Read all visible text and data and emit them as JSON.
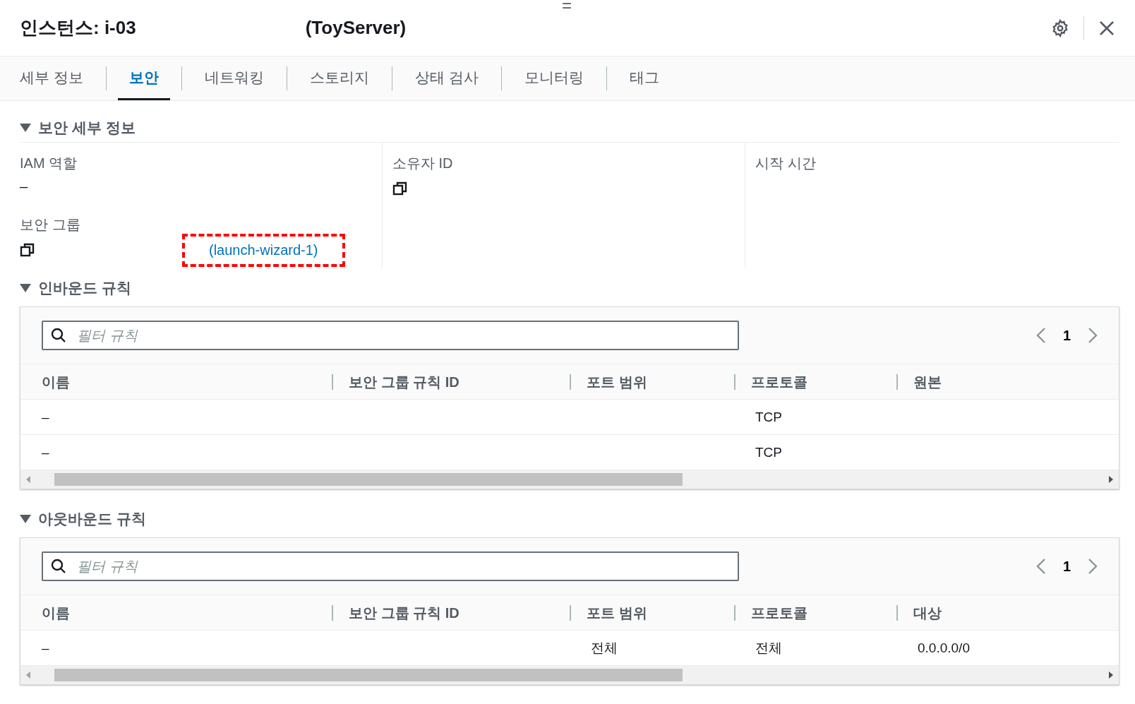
{
  "header": {
    "title": "인스턴스: i-03",
    "subtitle": "(ToyServer)",
    "handle": "="
  },
  "tabs": [
    {
      "label": "세부 정보",
      "selected": false
    },
    {
      "label": "보안",
      "selected": true
    },
    {
      "label": "네트워킹",
      "selected": false
    },
    {
      "label": "스토리지",
      "selected": false
    },
    {
      "label": "상태 검사",
      "selected": false
    },
    {
      "label": "모니터링",
      "selected": false
    },
    {
      "label": "태그",
      "selected": false
    }
  ],
  "security_details": {
    "heading": "보안 세부 정보",
    "expanded": true,
    "iam_role": {
      "label": "IAM 역할",
      "value": "–"
    },
    "owner_id": {
      "label": "소유자 ID"
    },
    "launch_time": {
      "label": "시작 시간"
    },
    "security_group": {
      "label": "보안 그룹",
      "link": "(launch-wizard-1)",
      "highlighted": true
    }
  },
  "rule_tables": [
    {
      "heading": "인바운드 규칙",
      "expanded": true,
      "filter_placeholder": "필터 규칙",
      "page": "1",
      "columns": [
        "이름",
        "보안 그룹 규칙 ID",
        "포트 범위",
        "프로토콜",
        "원본"
      ],
      "rows": [
        [
          "–",
          null,
          null,
          "TCP",
          null
        ],
        [
          "–",
          null,
          null,
          "TCP",
          null
        ]
      ]
    },
    {
      "heading": "아웃바운드 규칙",
      "expanded": true,
      "filter_placeholder": "필터 규칙",
      "page": "1",
      "columns": [
        "이름",
        "보안 그룹 규칙 ID",
        "포트 범위",
        "프로토콜",
        "대상"
      ],
      "rows": [
        [
          "–",
          null,
          "전체",
          "전체",
          "0.0.0.0/0"
        ]
      ]
    }
  ]
}
